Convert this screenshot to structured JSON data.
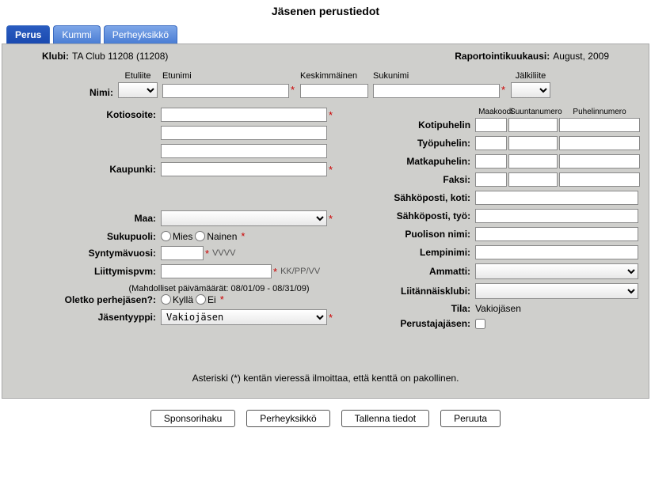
{
  "title": "Jäsenen perustiedot",
  "tabs": [
    "Perus",
    "Kummi",
    "Perheyksikkö"
  ],
  "header": {
    "klubi_lbl": "Klubi:",
    "klubi_val": "TA Club 11208 (11208)",
    "raportti_lbl": "Raportointikuukausi:",
    "raportti_val": "August, 2009"
  },
  "name": {
    "label": "Nimi:",
    "etuliite": "Etuliite",
    "etunimi": "Etunimi",
    "keskimmainen": "Keskimmäinen",
    "sukunimi": "Sukunimi",
    "jalkiliite": "Jälkiliite"
  },
  "left": {
    "kotiosoite": "Kotiosoite:",
    "kaupunki": "Kaupunki:",
    "maa": "Maa:",
    "sukupuoli": "Sukupuoli:",
    "mies": "Mies",
    "nainen": "Nainen",
    "syntymavuosi": "Syntymävuosi:",
    "vvvv": "VVVV",
    "liittymispvm": "Liittymispvm:",
    "kkppvv": "KK/PP/VV",
    "mahdolliset": "(Mahdolliset päivämäärät: 08/01/09 - 08/31/09)",
    "perhejasen": "Oletko perhejäsen?:",
    "kylla": "Kyllä",
    "ei": "Ei",
    "jasentyyppi": "Jäsentyyppi:",
    "jasentyyppi_val": "Vakiojäsen"
  },
  "right": {
    "maakoodi": "Maakoodi",
    "suunta": "Suuntanumero",
    "puhelin": "Puhelinnumero",
    "kotipuhelin": "Kotipuhelin",
    "tyopuhelin": "Työpuhelin:",
    "matkapuhelin": "Matkapuhelin:",
    "faksi": "Faksi:",
    "sahkoposti_koti": "Sähköposti, koti:",
    "sahkoposti_tyo": "Sähköposti, työ:",
    "puolison_nimi": "Puolison nimi:",
    "lempinimi": "Lempinimi:",
    "ammatti": "Ammatti:",
    "liitannaisklubi": "Liitännäisklubi:",
    "tila_lbl": "Tila:",
    "tila_val": "Vakiojäsen",
    "perustajajasen": "Perustajajäsen:"
  },
  "footnote": "Asteriski (*) kentän vieressä ilmoittaa, että kenttä on pakollinen.",
  "buttons": {
    "sponsorihaku": "Sponsorihaku",
    "perheyksikko": "Perheyksikkö",
    "tallenna": "Tallenna tiedot",
    "peruuta": "Peruuta"
  }
}
